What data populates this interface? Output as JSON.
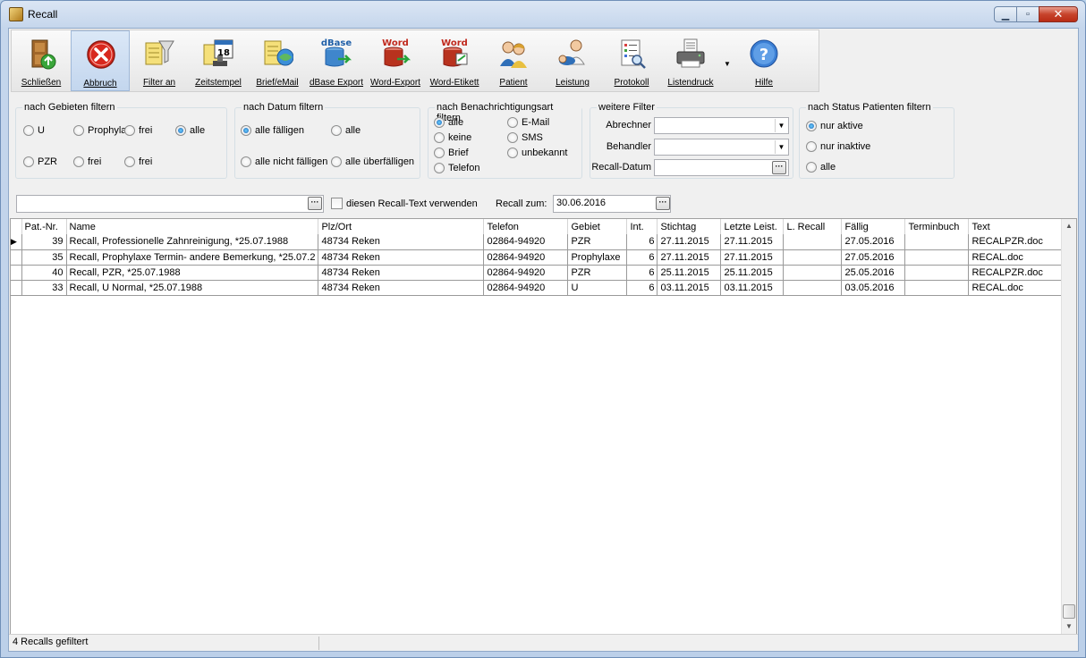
{
  "window": {
    "title": "Recall",
    "min_glyph": "▁",
    "max_glyph": "▫",
    "close_glyph": "✕"
  },
  "toolbar": {
    "items": [
      {
        "label": "Schließen",
        "icon": "door-exit-icon"
      },
      {
        "label": "Abbruch",
        "icon": "cancel-icon"
      },
      {
        "label": "Filter an",
        "icon": "funnel-filter-icon"
      },
      {
        "label": "Zeitstempel",
        "icon": "calendar-stamp-icon"
      },
      {
        "label": "Brief/eMail",
        "icon": "letter-mail-icon"
      },
      {
        "label": "dBase Export",
        "icon": "dbase-export-icon",
        "badge": "dBase"
      },
      {
        "label": "Word-Export",
        "icon": "word-export-icon",
        "badge": "Word"
      },
      {
        "label": "Word-Etikett",
        "icon": "word-label-icon",
        "badge": "Word"
      },
      {
        "label": "Patient",
        "icon": "patient-icon"
      },
      {
        "label": "Leistung",
        "icon": "treatment-icon"
      },
      {
        "label": "Protokoll",
        "icon": "protocol-icon"
      },
      {
        "label": "Listendruck",
        "icon": "printer-icon"
      },
      {
        "label": "Hilfe",
        "icon": "help-icon"
      }
    ],
    "dropdown_glyph": "▼"
  },
  "filters": {
    "gebiete": {
      "title": "nach Gebieten filtern",
      "options": [
        "U",
        "Prophyla",
        "frei",
        "alle",
        "PZR",
        "frei",
        "frei"
      ],
      "selected": "alle"
    },
    "datum": {
      "title": "nach Datum filtern",
      "options": [
        "alle fälligen",
        "alle",
        "alle nicht fälligen",
        "alle überfälligen"
      ],
      "selected": "alle fälligen"
    },
    "benachrichtigung": {
      "title": "nach Benachrichtigungsart filtern",
      "options": [
        "alle",
        "keine",
        "Brief",
        "Telefon",
        "E-Mail",
        "SMS",
        "unbekannt"
      ],
      "selected": "alle"
    },
    "weitere": {
      "title": "weitere Filter",
      "abrechner_label": "Abrechner",
      "abrechner_value": "",
      "behandler_label": "Behandler",
      "behandler_value": "",
      "recall_datum_label": "Recall-Datum",
      "recall_datum_value": ""
    },
    "status": {
      "title": "nach Status Patienten filtern",
      "options": [
        "nur aktive",
        "nur inaktive",
        "alle"
      ],
      "selected": "nur aktive"
    }
  },
  "recall_text": {
    "value": "",
    "checkbox_label": "diesen Recall-Text verwenden",
    "checked": false,
    "recall_zum_label": "Recall zum:",
    "recall_zum_value": "30.06.2016"
  },
  "grid": {
    "columns": [
      "Pat.-Nr.",
      "Name",
      "Plz/Ort",
      "Telefon",
      "Gebiet",
      "Int.",
      "Stichtag",
      "Letzte Leist.",
      "L. Recall",
      "Fällig",
      "Terminbuch",
      "Text"
    ],
    "rows": [
      [
        "39",
        "Recall, Professionelle Zahnreinigung, *25.07.1988",
        "48734 Reken",
        "02864-94920",
        "PZR",
        "6",
        "27.11.2015",
        "27.11.2015",
        "",
        "27.05.2016",
        "",
        "RECALPZR.doc"
      ],
      [
        "35",
        "Recall, Prophylaxe Termin- andere Bemerkung, *25.07.2",
        "48734 Reken",
        "02864-94920",
        "Prophylaxe",
        "6",
        "27.11.2015",
        "27.11.2015",
        "",
        "27.05.2016",
        "",
        "RECAL.doc"
      ],
      [
        "40",
        "Recall, PZR, *25.07.1988",
        "48734 Reken",
        "02864-94920",
        "PZR",
        "6",
        "25.11.2015",
        "25.11.2015",
        "",
        "25.05.2016",
        "",
        "RECALPZR.doc"
      ],
      [
        "33",
        "Recall, U Normal, *25.07.1988",
        "48734 Reken",
        "02864-94920",
        "U",
        "6",
        "03.11.2015",
        "03.11.2015",
        "",
        "03.05.2016",
        "",
        "RECAL.doc"
      ]
    ],
    "current_row_marker": "▶"
  },
  "status_bar": {
    "text": "4 Recalls gefiltert"
  },
  "colors": {
    "accent": "#1a5fb4",
    "close_red": "#c7432c",
    "word_red": "#c0281c",
    "dbase_blue": "#1f5fa8"
  }
}
